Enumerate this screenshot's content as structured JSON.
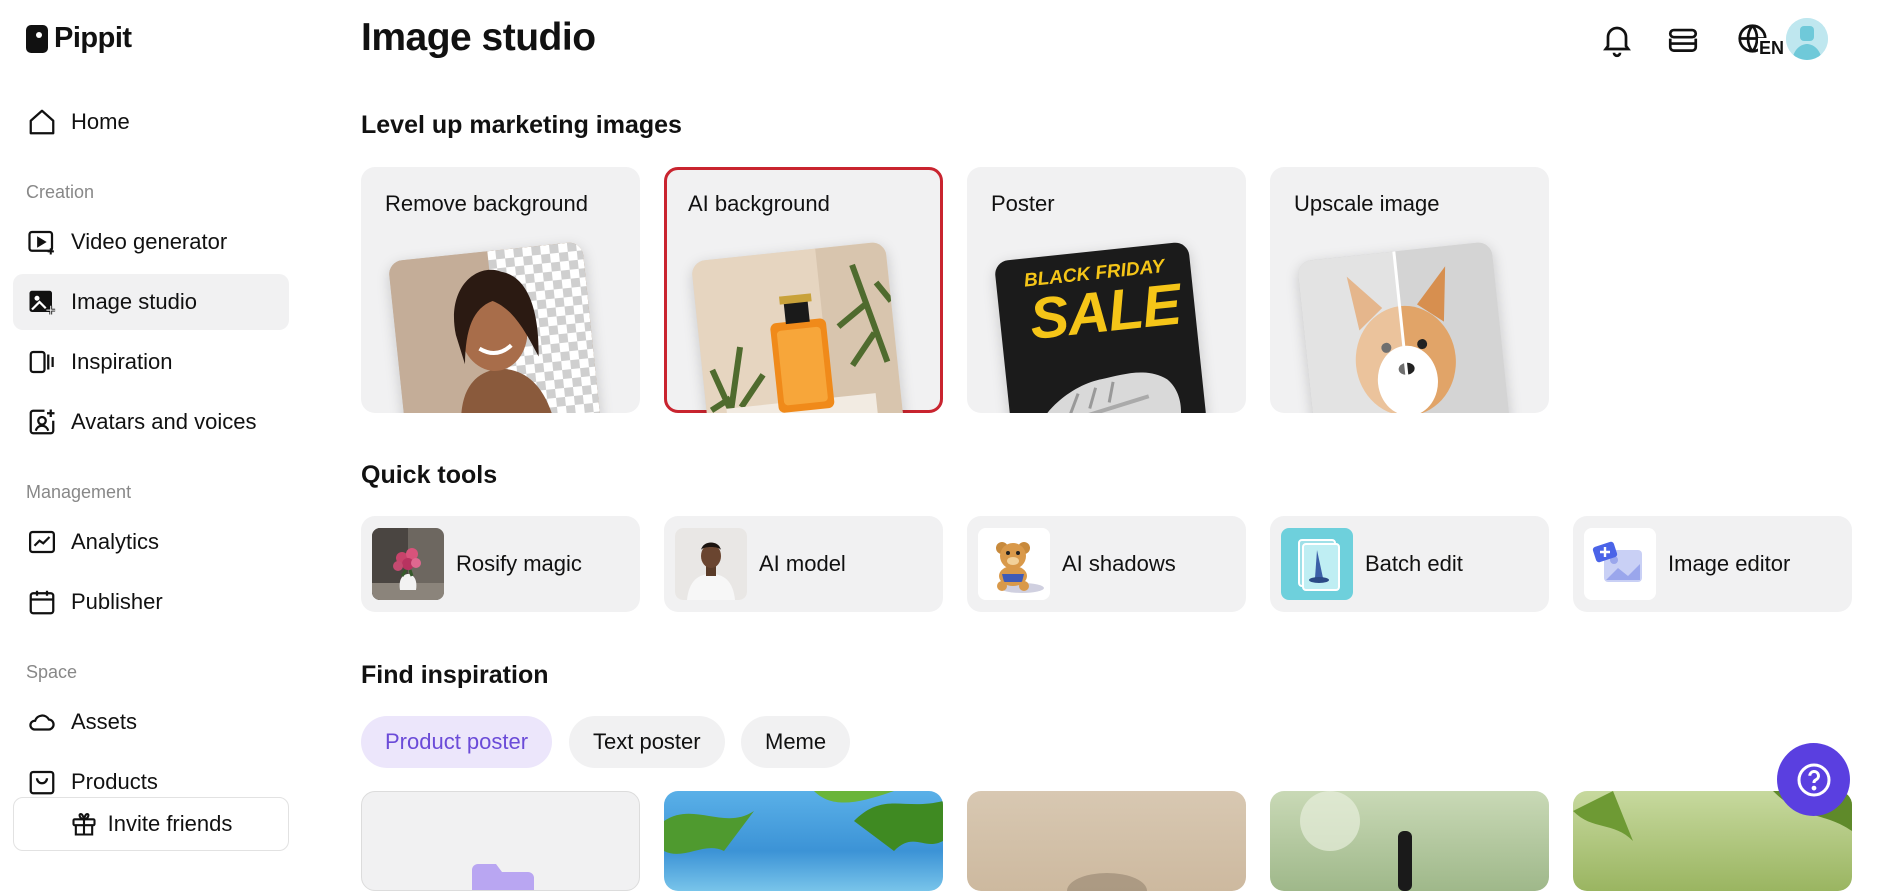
{
  "app": {
    "brand": "Pippit"
  },
  "sidebar": {
    "home": "Home",
    "sections": {
      "creation": "Creation",
      "management": "Management",
      "space": "Space"
    },
    "items": [
      {
        "label": "Home",
        "icon": "home-icon"
      },
      {
        "label": "Video generator",
        "icon": "video-generator-icon"
      },
      {
        "label": "Image studio",
        "icon": "image-studio-icon",
        "active": true
      },
      {
        "label": "Inspiration",
        "icon": "inspiration-icon"
      },
      {
        "label": "Avatars and voices",
        "icon": "avatar-icon"
      },
      {
        "label": "Analytics",
        "icon": "analytics-icon"
      },
      {
        "label": "Publisher",
        "icon": "calendar-icon"
      },
      {
        "label": "Assets",
        "icon": "cloud-icon"
      },
      {
        "label": "Products",
        "icon": "bag-icon"
      }
    ],
    "invite": "Invite friends"
  },
  "header": {
    "title": "Image studio",
    "language": "EN"
  },
  "marketing": {
    "heading": "Level up marketing images",
    "cards": [
      {
        "label": "Remove background"
      },
      {
        "label": "AI background",
        "selected": true
      },
      {
        "label": "Poster",
        "poster_top": "BLACK FRIDAY",
        "poster_main": "SALE"
      },
      {
        "label": "Upscale image"
      }
    ]
  },
  "quick_tools": {
    "heading": "Quick tools",
    "tools": [
      {
        "label": "Rosify magic"
      },
      {
        "label": "AI model"
      },
      {
        "label": "AI shadows"
      },
      {
        "label": "Batch edit"
      },
      {
        "label": "Image editor"
      }
    ]
  },
  "inspiration": {
    "heading": "Find inspiration",
    "chips": [
      {
        "label": "Product poster",
        "active": true
      },
      {
        "label": "Text poster"
      },
      {
        "label": "Meme"
      }
    ]
  },
  "colors": {
    "accent": "#5a3fe0",
    "selection_outline": "#c9242f",
    "card_bg": "#f1f1f2"
  }
}
